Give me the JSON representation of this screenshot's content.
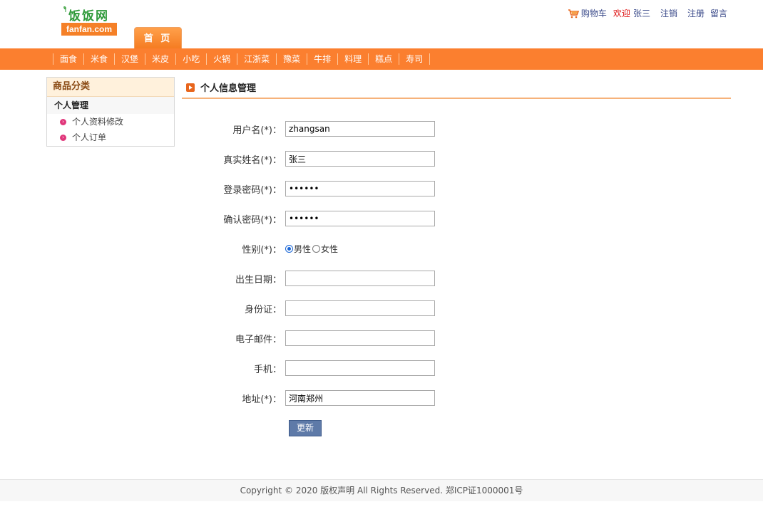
{
  "header": {
    "logo_cn": "饭饭网",
    "logo_en": "fanfan.com",
    "cart_label": "购物车",
    "welcome_label": "欢迎",
    "username": "张三",
    "logout_label": "注销",
    "register_label": "注册",
    "message_label": "留言",
    "home_tab": "首 页"
  },
  "nav": {
    "items": [
      "面食",
      "米食",
      "汉堡",
      "米皮",
      "小吃",
      "火锅",
      "江浙菜",
      "豫菜",
      "牛排",
      "料理",
      "糕点",
      "寿司"
    ]
  },
  "sidebar": {
    "title": "商品分类",
    "section": "个人管理",
    "items": [
      {
        "label": "个人资料修改"
      },
      {
        "label": "个人订单"
      }
    ]
  },
  "main": {
    "title": "个人信息管理",
    "fields": {
      "username": {
        "label": "用户名(*)：",
        "value": "zhangsan"
      },
      "realname": {
        "label": "真实姓名(*)：",
        "value": "张三"
      },
      "password": {
        "label": "登录密码(*)：",
        "value": "••••••"
      },
      "confirm": {
        "label": "确认密码(*)：",
        "value": "••••••"
      },
      "gender": {
        "label": "性别(*)：",
        "option_male": "男性",
        "option_female": "女性",
        "selected": "男性"
      },
      "birthday": {
        "label": "出生日期：",
        "value": ""
      },
      "idcard": {
        "label": "身份证：",
        "value": ""
      },
      "email": {
        "label": "电子邮件：",
        "value": ""
      },
      "phone": {
        "label": "手机：",
        "value": ""
      },
      "address": {
        "label": "地址(*)：",
        "value": "河南郑州"
      }
    },
    "submit_label": "更新"
  },
  "footer": {
    "text": "Copyright © 2020 版权声明 All Rights Reserved. 郑ICP证1000001号"
  },
  "colors": {
    "brand_orange": "#fb7f2f",
    "brand_green": "#2f9a3a",
    "button_blue": "#5e7aa8"
  }
}
